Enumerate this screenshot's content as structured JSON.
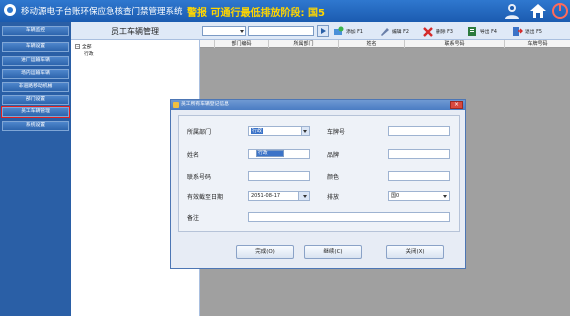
{
  "app": {
    "title": "移动源电子台账环保应急核查门禁管理系统",
    "warning": "警报 可通行最低排放阶段: 国5"
  },
  "sidebar": {
    "items": [
      {
        "label": "车辆监控"
      },
      {
        "label": "车辆设置"
      },
      {
        "label": "进厂运输车辆"
      },
      {
        "label": "场内运输车辆"
      },
      {
        "label": "非道路移动机械"
      },
      {
        "label": "部门设置"
      },
      {
        "label": "员工车辆管理"
      },
      {
        "label": "系统设置"
      }
    ]
  },
  "header": {
    "page_title": "员工车辆管理",
    "toolbar": {
      "add": "添加 F1",
      "edit": "编辑 F2",
      "delete": "删除 F3",
      "export": "导出 F4",
      "exit": "退出 F5"
    }
  },
  "tree": {
    "root": "全部",
    "child": "行政"
  },
  "grid": {
    "columns": [
      "部门编码",
      "所属部门",
      "姓名",
      "联系号码",
      "车牌号码"
    ]
  },
  "dialog": {
    "title": "员工所有车辆登记信息",
    "close": "×",
    "labels": {
      "dept": "所属部门",
      "plate": "车牌号",
      "name": "姓名",
      "brand": "品牌",
      "phone": "联系号码",
      "color": "颜色",
      "expiry": "有效截至日期",
      "emission": "排放",
      "remark": "备注"
    },
    "values": {
      "dept": "行政",
      "dept_option": "行政",
      "expiry": "2051-08-17",
      "emission": "国0"
    },
    "buttons": {
      "done": "完成(O)",
      "continue": "继续(C)",
      "close": "关闭(X)"
    }
  },
  "colors": {
    "topbar": "#1b5bb0",
    "warning": "#ffd600",
    "sidebar": "#2a5fa6",
    "active_outline": "#e02020"
  }
}
